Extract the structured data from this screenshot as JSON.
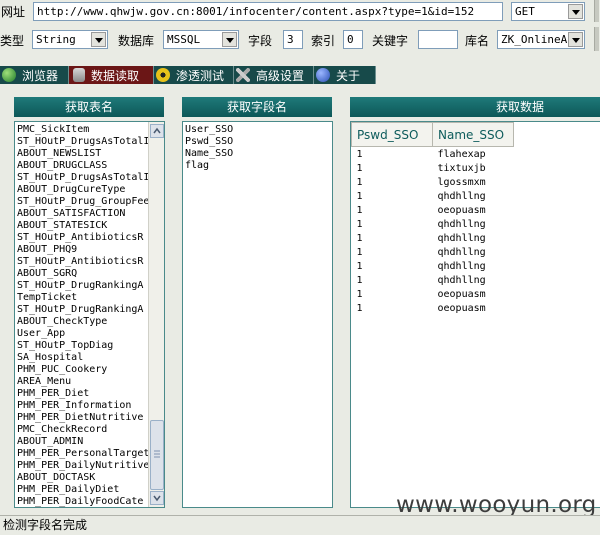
{
  "toolbar": {
    "url_label": "网址",
    "url_value": "http://www.qhwjw.gov.cn:8001/infocenter/content.aspx?type=1&id=152",
    "method_value": "GET",
    "type_label": "类型",
    "type_value": "String",
    "db_label": "数据库",
    "db_value": "MSSQL",
    "field_label": "字段",
    "field_value": "3",
    "index_label": "索引",
    "index_value": "0",
    "keyword_label": "关键字",
    "keyword_value": "",
    "dbname_label": "库名",
    "dbname_value": "ZK_OnlineAb"
  },
  "tabs": [
    {
      "label": "浏览器",
      "icon": "globe-icon"
    },
    {
      "label": "数据读取",
      "icon": "database-icon"
    },
    {
      "label": "渗透测试",
      "icon": "radiation-icon"
    },
    {
      "label": "高级设置",
      "icon": "tools-icon"
    },
    {
      "label": "关于",
      "icon": "info-icon"
    }
  ],
  "tables_panel": {
    "title": "获取表名",
    "items": [
      "PMC_SickItem",
      "ST_HOutP_DrugsAsTotalI",
      "ABOUT_NEWSLIST",
      "ABOUT_DRUGCLASS",
      "ST_HOutP_DrugsAsTotalI",
      "ABOUT_DrugCureType",
      "ST_HOutP_Drug_GroupFee",
      "ABOUT_SATISFACTION",
      "ABOUT_STATESICK",
      "ST_HOutP_AntibioticsR",
      "ABOUT_PHQ9",
      "ST_HOutP_AntibioticsR",
      "ABOUT_SGRQ",
      "ST_HOutP_DrugRankingA",
      "TempTicket",
      "ST_HOutP_DrugRankingA",
      "ABOUT_CheckType",
      "User_App",
      "ST_HOutP_TopDiag",
      "SA_Hospital",
      "PHM_PUC_Cookery",
      "AREA_Menu",
      "PHM_PER_Diet",
      "PHM_PER_Information",
      "PHM_PER_DietNutritive",
      "PMC_CheckRecord",
      "ABOUT_ADMIN",
      "PHM_PER_PersonalTarget",
      "PHM_PER_DailyNutritive",
      "ABOUT_DOCTASK",
      "PHM_PER_DailyDiet",
      "PHM_PER_DailyFoodCate"
    ]
  },
  "fields_panel": {
    "title": "获取字段名",
    "items": [
      "User_SSO",
      "Pswd_SSO",
      "Name_SSO",
      "flag"
    ]
  },
  "data_panel": {
    "title": "获取数据",
    "columns": [
      "Pswd_SSO",
      "Name_SSO"
    ],
    "rows": [
      [
        "1",
        "flahexap"
      ],
      [
        "1",
        "tixtuxjb"
      ],
      [
        "1",
        "lgossmxm"
      ],
      [
        "1",
        "qhdhllng"
      ],
      [
        "1",
        "oeopuasm"
      ],
      [
        "1",
        "qhdhllng"
      ],
      [
        "1",
        "qhdhllng"
      ],
      [
        "1",
        "qhdhllng"
      ],
      [
        "1",
        "qhdhllng"
      ],
      [
        "1",
        "qhdhllng"
      ],
      [
        "1",
        "oeopuasm"
      ],
      [
        "1",
        "oeopuasm"
      ]
    ]
  },
  "status_text": "检测字段名完成",
  "watermark": "www.wooyun.org"
}
